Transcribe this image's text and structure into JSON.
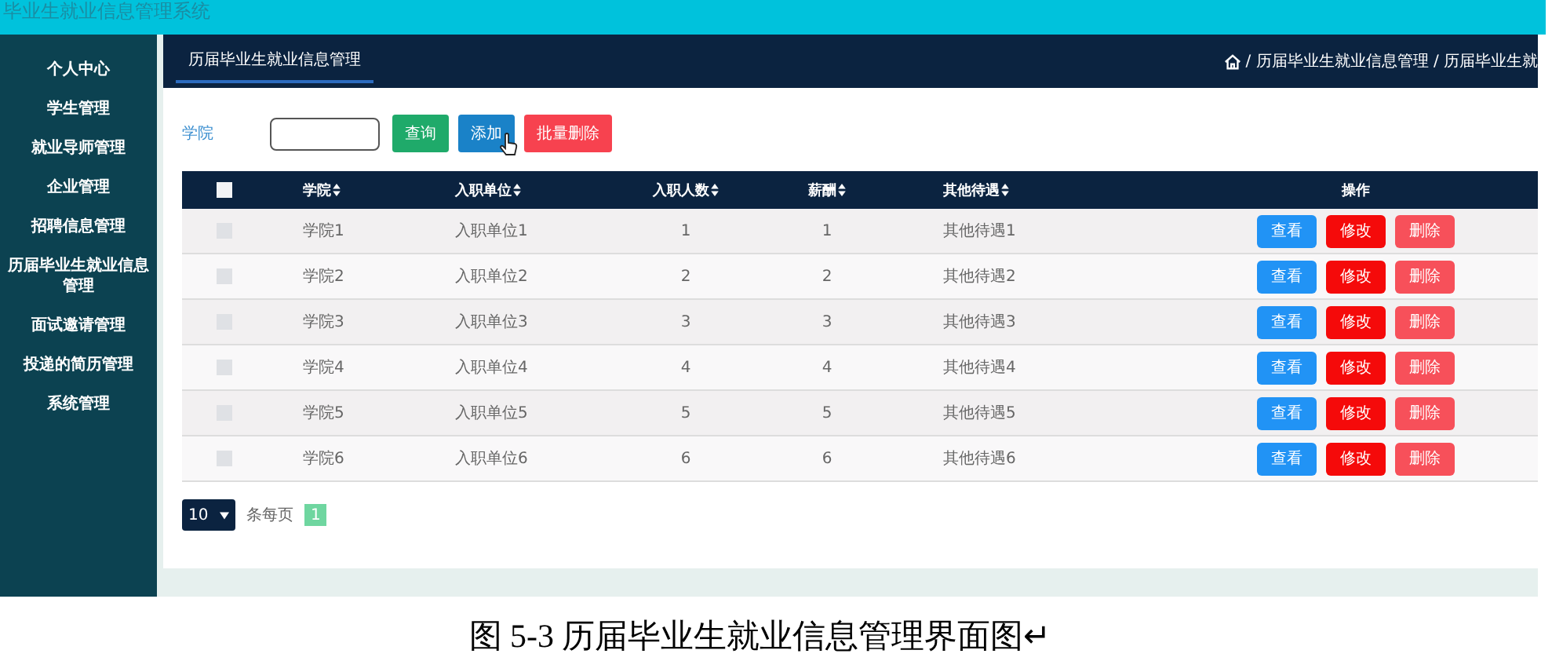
{
  "app_title": "毕业生就业信息管理系统",
  "sidebar": {
    "items": [
      {
        "label": "个人中心"
      },
      {
        "label": "学生管理"
      },
      {
        "label": "就业导师管理"
      },
      {
        "label": "企业管理"
      },
      {
        "label": "招聘信息管理"
      },
      {
        "label": "历届毕业生就业信息管理"
      },
      {
        "label": "面试邀请管理"
      },
      {
        "label": "投递的简历管理"
      },
      {
        "label": "系统管理"
      }
    ]
  },
  "header": {
    "tab": "历届毕业生就业信息管理",
    "breadcrumb": "/ 历届毕业生就业信息管理 / 历届毕业生就"
  },
  "search": {
    "label": "学院",
    "buttons": [
      {
        "label": "查询",
        "kind": "query"
      },
      {
        "label": "添加",
        "kind": "add"
      },
      {
        "label": "批量删除",
        "kind": "batch-delete"
      }
    ]
  },
  "table": {
    "select_all_checked": false,
    "columns": [
      {
        "label": "学院",
        "sortable": true
      },
      {
        "label": "入职单位",
        "sortable": true
      },
      {
        "label": "入职人数",
        "sortable": true
      },
      {
        "label": "薪酬",
        "sortable": true
      },
      {
        "label": "其他待遇",
        "sortable": true
      },
      {
        "label": "操作",
        "sortable": false
      }
    ],
    "rows": [
      {
        "checked": false,
        "cells": [
          "学院1",
          "入职单位1",
          "1",
          "1",
          "其他待遇1"
        ],
        "actions": [
          {
            "label": "查看",
            "kind": "view"
          },
          {
            "label": "修改",
            "kind": "edit"
          },
          {
            "label": "删除",
            "kind": "delete"
          }
        ]
      },
      {
        "checked": false,
        "cells": [
          "学院2",
          "入职单位2",
          "2",
          "2",
          "其他待遇2"
        ],
        "actions": [
          {
            "label": "查看",
            "kind": "view"
          },
          {
            "label": "修改",
            "kind": "edit"
          },
          {
            "label": "删除",
            "kind": "delete"
          }
        ]
      },
      {
        "checked": false,
        "cells": [
          "学院3",
          "入职单位3",
          "3",
          "3",
          "其他待遇3"
        ],
        "actions": [
          {
            "label": "查看",
            "kind": "view"
          },
          {
            "label": "修改",
            "kind": "edit"
          },
          {
            "label": "删除",
            "kind": "delete"
          }
        ]
      },
      {
        "checked": false,
        "cells": [
          "学院4",
          "入职单位4",
          "4",
          "4",
          "其他待遇4"
        ],
        "actions": [
          {
            "label": "查看",
            "kind": "view"
          },
          {
            "label": "修改",
            "kind": "edit"
          },
          {
            "label": "删除",
            "kind": "delete"
          }
        ]
      },
      {
        "checked": false,
        "cells": [
          "学院5",
          "入职单位5",
          "5",
          "5",
          "其他待遇5"
        ],
        "actions": [
          {
            "label": "查看",
            "kind": "view"
          },
          {
            "label": "修改",
            "kind": "edit"
          },
          {
            "label": "删除",
            "kind": "delete"
          }
        ]
      },
      {
        "checked": false,
        "cells": [
          "学院6",
          "入职单位6",
          "6",
          "6",
          "其他待遇6"
        ],
        "actions": [
          {
            "label": "查看",
            "kind": "view"
          },
          {
            "label": "修改",
            "kind": "edit"
          },
          {
            "label": "删除",
            "kind": "delete"
          }
        ]
      }
    ]
  },
  "pagination": {
    "page_size": "10",
    "per_page_label": "条每页",
    "pages": [
      {
        "label": "1",
        "selected": true
      }
    ]
  },
  "caption": "图 5-3 历届毕业生就业信息管理界面图↵"
}
